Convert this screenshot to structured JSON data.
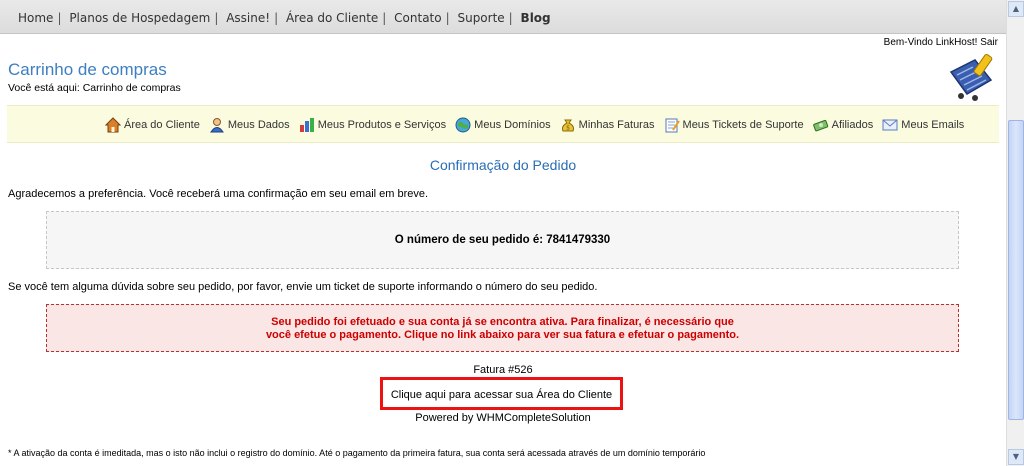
{
  "topnav": {
    "items": [
      {
        "label": "Home",
        "bold": false
      },
      {
        "label": "Planos de Hospedagem",
        "bold": false
      },
      {
        "label": "Assine!",
        "bold": false
      },
      {
        "label": "Área do Cliente",
        "bold": false
      },
      {
        "label": "Contato",
        "bold": false
      },
      {
        "label": "Suporte",
        "bold": false
      },
      {
        "label": "Blog",
        "bold": true
      }
    ],
    "separator": "|"
  },
  "welcome": {
    "text": "Bem-Vindo LinkHost!",
    "logout_label": "Sair"
  },
  "page": {
    "title": "Carrinho de compras",
    "breadcrumb": "Você está aqui: Carrinho de compras"
  },
  "client_menu": {
    "items": [
      {
        "label": "Área do Cliente",
        "icon": "home-icon"
      },
      {
        "label": "Meus Dados",
        "icon": "user-icon"
      },
      {
        "label": "Meus Produtos e Serviços",
        "icon": "bar-chart-icon"
      },
      {
        "label": "Meus Domínios",
        "icon": "globe-icon"
      },
      {
        "label": "Minhas Faturas",
        "icon": "money-bag-icon"
      },
      {
        "label": "Meus Tickets de Suporte",
        "icon": "ticket-icon"
      },
      {
        "label": "Afiliados",
        "icon": "cash-icon"
      },
      {
        "label": "Meus Emails",
        "icon": "envelope-icon"
      }
    ]
  },
  "confirmation": {
    "title": "Confirmação do Pedido",
    "thanks": "Agradecemos a preferência. Você receberá uma confirmação em seu email em breve.",
    "order_number_text": "O número de seu pedido é: 7841479330",
    "doubt_text": "Se você tem alguma dúvida sobre seu pedido, por favor, envie um ticket de suporte informando o número do seu pedido.",
    "alert_line1": "Seu pedido foi efetuado e sua conta já se encontra ativa. Para finalizar, é necessário que",
    "alert_line2": "você efetue o pagamento. Clique no link abaixo para ver sua fatura e efetuar o pagamento.",
    "invoice_label": "Fatura #526",
    "client_area_link": "Clique aqui para acessar sua Área do Cliente",
    "powered_by": "Powered by WHMCompleteSolution",
    "footnote": "* A ativação da conta é imeditada, mas o isto não inclui o registro do domínio. Até o pagamento da primeira fatura, sua conta será acessada através de um domínio temporário"
  },
  "colors": {
    "title_blue": "#3d7fc1",
    "menu_background": "#fbfbdf",
    "alert_red": "#cc0000",
    "highlight_border": "#ee1111"
  }
}
